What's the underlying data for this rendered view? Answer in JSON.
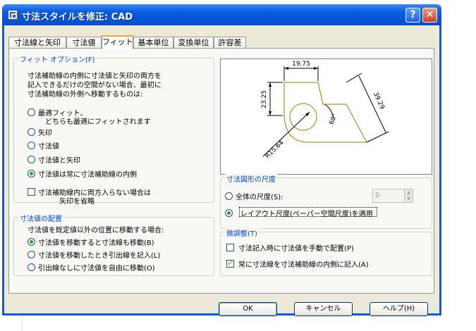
{
  "window": {
    "title": "寸法スタイルを修正: CAD",
    "help_glyph": "?",
    "close_glyph": "✕"
  },
  "tabs": [
    "寸法線と矢印",
    "寸法値",
    "フィット",
    "基本単位",
    "変換単位",
    "許容差"
  ],
  "active_tab": "フィット",
  "fit_options": {
    "legend": "フィット オプション(F)",
    "description": [
      "寸法補助線の内側に寸法値と矢印の両方を",
      "記入できるだけの空間がない場合、最初に",
      "寸法補助線の外側へ移動するものは:"
    ],
    "radios": [
      {
        "label": "最適フィット、",
        "sub": "どちらも最適にフィットされます",
        "selected": false
      },
      {
        "label": "矢印",
        "selected": false
      },
      {
        "label": "寸法値",
        "selected": false
      },
      {
        "label": "寸法値と矢印",
        "selected": false
      },
      {
        "label": "寸法値は常に寸法補助線の内側",
        "selected": true
      }
    ],
    "suppress_check": {
      "label": "寸法補助線内に両方入らない場合は",
      "sub": "矢印を省略",
      "checked": false
    }
  },
  "text_placement": {
    "legend": "寸法値の配置",
    "description": "寸法値を既定値以外の位置に移動する場合:",
    "radios": [
      {
        "label": "寸法値を移動すると寸法線も移動(B)",
        "selected": true
      },
      {
        "label": "寸法値を移動したとき引出線を記入(L)",
        "selected": false
      },
      {
        "label": "引出線なしに寸法値を自由に移動(O)",
        "selected": false
      }
    ]
  },
  "preview": {
    "dim_top": "19.75",
    "dim_left": "23.25",
    "dim_right": "39.29",
    "angle": "60°",
    "radius": "R15.64"
  },
  "scale": {
    "legend": "寸法図形の尺度",
    "overall_label": "全体の尺度(S):",
    "overall_selected": false,
    "overall_value": "0",
    "layout_label": "レイアウト尺度(ペーパー空間尺度)を適用",
    "layout_selected": true
  },
  "fine_tuning": {
    "legend": "微調整(T)",
    "manual_label": "寸法記入時に寸法値を手動で配置(P)",
    "manual_checked": false,
    "draw_label": "常に寸法線を寸法補助線の内側に記入(A)",
    "draw_checked": true
  },
  "buttons": {
    "ok": "OK",
    "cancel": "キャンセル",
    "help": "ヘルプ(H)"
  }
}
